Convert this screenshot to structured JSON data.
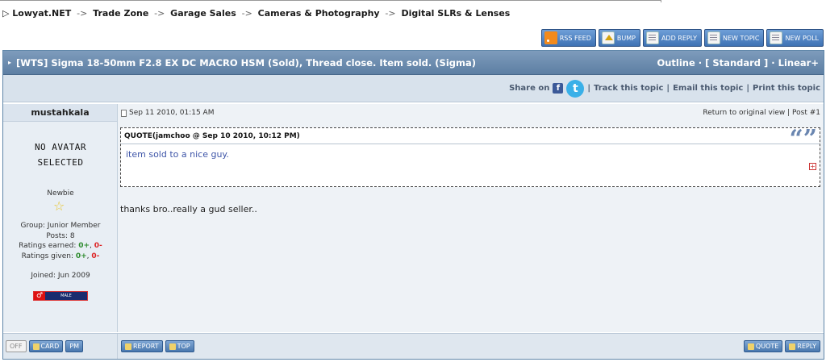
{
  "breadcrumb": [
    "Lowyat.NET",
    "Trade Zone",
    "Garage Sales",
    "Cameras & Photography",
    "Digital SLRs & Lenses"
  ],
  "breadcrumb_sep": "->",
  "actions": {
    "rss": "RSS FEED",
    "bump": "BUMP",
    "add_reply": "ADD REPLY",
    "new_topic": "NEW TOPIC",
    "new_poll": "NEW POLL"
  },
  "topic": {
    "title": "[WTS] Sigma 18-50mm F2.8 EX DC MACRO HSM (Sold), Thread close. Item sold. (Sigma)",
    "modes": "Outline · [ Standard ] · Linear+"
  },
  "share": {
    "label": "Share on",
    "fb": "f",
    "tw": "t",
    "track": "Track this topic",
    "email": "Email this topic",
    "print": "Print this topic",
    "sep": "|"
  },
  "user": {
    "name": "mustahkala",
    "no_avatar_line1": "NO AVATAR",
    "no_avatar_line2": "SELECTED",
    "rank": "Newbie",
    "group": "Group: Junior Member",
    "posts": "Posts: 8",
    "ratings_earned_label": "Ratings earned:",
    "ratings_earned_pos": "0+",
    "ratings_earned_neg": "0-",
    "ratings_given_label": "Ratings given:",
    "ratings_given_pos": "0+",
    "ratings_given_neg": "0-",
    "joined": "Joined: Jun 2009",
    "gender": "MALE"
  },
  "post": {
    "date": "Sep 11 2010, 01:15 AM",
    "return": "Return to original view",
    "postnum": "Post #1",
    "quote_header": "QUOTE(jamchoo @ Sep 10 2010, 10:12 PM)",
    "quote_body": "item sold to a nice guy.",
    "body": "thanks bro..really a gud seller.."
  },
  "footer": {
    "off": "OFF",
    "card": "CARD",
    "pm": "PM",
    "report": "REPORT",
    "top": "TOP",
    "quote": "QUOTE",
    "reply": "REPLY"
  },
  "colors": {
    "titlebar": "#5d7fa3",
    "sharebar": "#d8e2ec",
    "button": "#4a78ae",
    "quote_text": "#3e55a8"
  }
}
